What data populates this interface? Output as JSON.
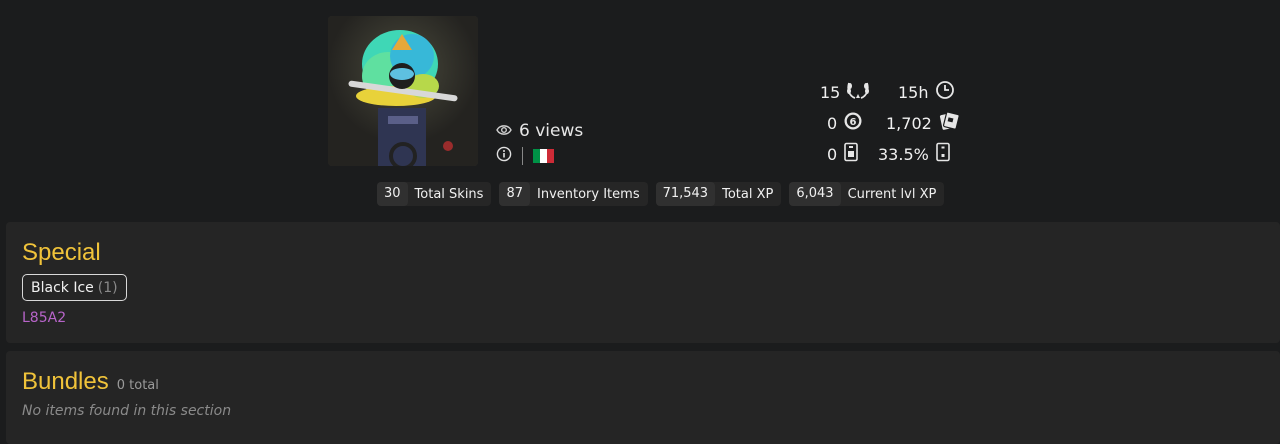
{
  "profile": {
    "views_label": "6 views",
    "icons": {
      "views": "eye-icon",
      "info": "info-icon",
      "flag": "italy-flag-icon"
    },
    "flag_colors": [
      "#009246",
      "#ffffff",
      "#ce2b37"
    ]
  },
  "stats": {
    "trophies": {
      "value": "15",
      "icon": "laurel-wreath-icon"
    },
    "hours": {
      "value": "15h",
      "icon": "clock-icon"
    },
    "credits": {
      "value": "0",
      "icon": "coin-icon"
    },
    "tickets": {
      "value": "1,702",
      "icon": "tickets-icon"
    },
    "cards_count": {
      "value": "0",
      "icon": "card-icon"
    },
    "cards_percent": {
      "value": "33.5%",
      "icon": "card-outline-icon"
    }
  },
  "chips": [
    {
      "value": "30",
      "label": "Total Skins"
    },
    {
      "value": "87",
      "label": "Inventory Items"
    },
    {
      "value": "71,543",
      "label": "Total XP"
    },
    {
      "value": "6,043",
      "label": "Current lvl XP"
    }
  ],
  "special": {
    "title": "Special",
    "pill_label": "Black Ice",
    "pill_count": "(1)",
    "link_text": "L85A2"
  },
  "bundles": {
    "title": "Bundles",
    "total": "0 total",
    "empty_text": "No items found in this section"
  },
  "colors": {
    "accent": "#f0c33a",
    "link": "#b764c9",
    "background": "#1b1c1d",
    "panel": "#252525"
  }
}
